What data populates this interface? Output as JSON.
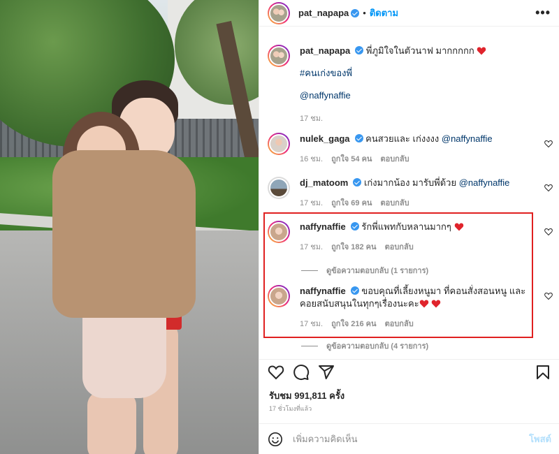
{
  "header": {
    "username": "pat_napapa",
    "follow_label": "ติดตาม",
    "more_label": "•••"
  },
  "caption": {
    "username": "pat_napapa",
    "text": "พี่ภูมิใจในตัวนาฟ มากกกกก",
    "hashtag": "#คนเก่งของพี่",
    "mention": "@naffynaffie",
    "time": "17 ชม."
  },
  "comments": [
    {
      "username": "nulek_gaga",
      "text": "คนสวยและ เก่งงงง",
      "mention": "@naffynaffie",
      "time": "16 ชม.",
      "likes": "ถูกใจ 54 คน",
      "reply": "ตอบกลับ"
    },
    {
      "username": "dj_matoom",
      "text": "เก่งมากน้อง มารับพี่ด้วย",
      "mention": "@naffynaffie",
      "time": "17 ชม.",
      "likes": "ถูกใจ 69 คน",
      "reply": "ตอบกลับ"
    },
    {
      "username": "naffynaffie",
      "text": "รักพี่แพทกับหลานมากๆ",
      "time": "17 ชม.",
      "likes": "ถูกใจ 182 คน",
      "reply": "ตอบกลับ",
      "view_replies": "ดูข้อความตอบกลับ (1 รายการ)"
    },
    {
      "username": "naffynaffie",
      "text": "ขอบคุณที่เลี้ยงหนูมา ที่คอนสั่งสอนหนู และคอยสนับสนุนในทุกๆเรื่องนะคะ",
      "time": "17 ชม.",
      "likes": "ถูกใจ 216 คน",
      "reply": "ตอบกลับ",
      "view_replies": "ดูข้อความตอบกลับ (4 รายการ)"
    }
  ],
  "footer": {
    "views": "รับชม 991,811 ครั้ง",
    "time_ago": "17 ชั่วโมงที่แล้ว",
    "add_comment_placeholder": "เพิ่มความคิดเห็น",
    "post_label": "โพสต์"
  },
  "colors": {
    "accent": "#0095f6",
    "highlight_box": "#e02020",
    "heart": "#ed4956"
  }
}
